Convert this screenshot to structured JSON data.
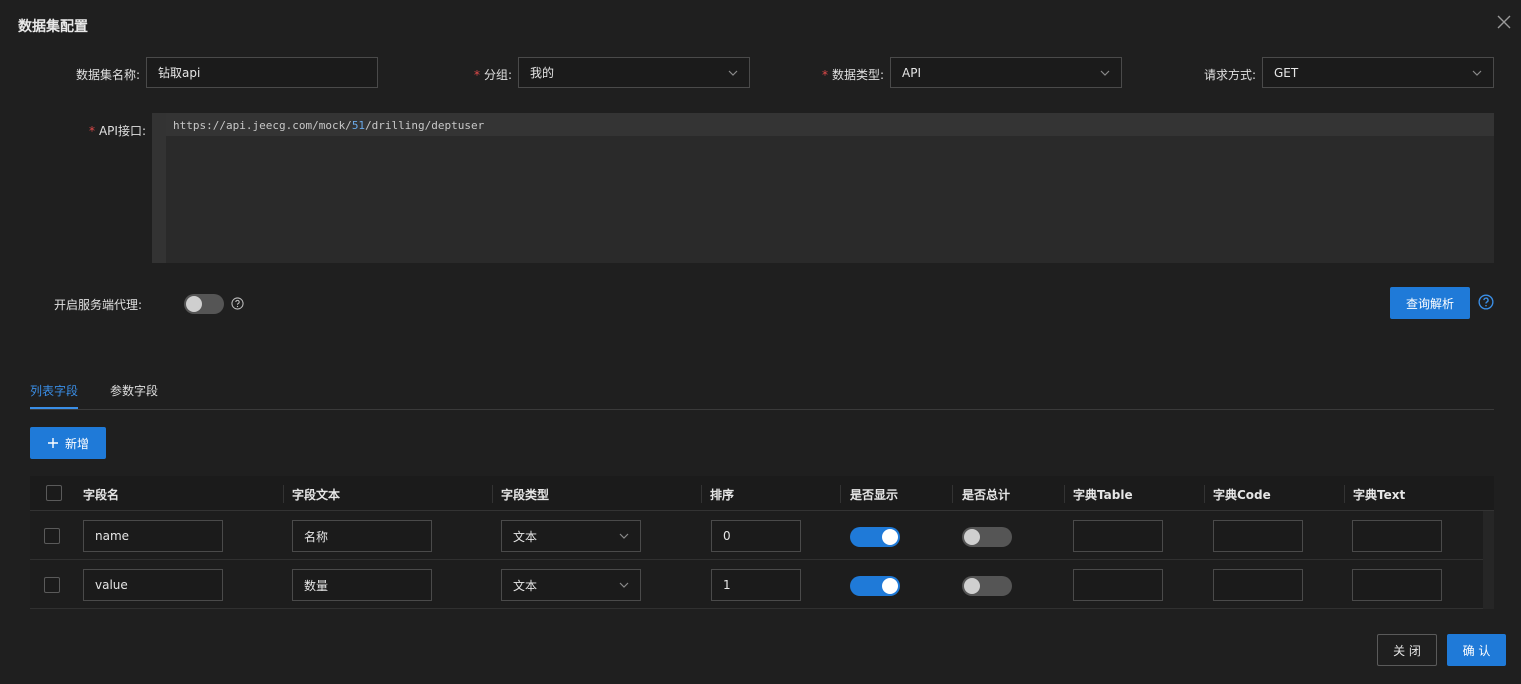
{
  "dialog": {
    "title": "数据集配置"
  },
  "form": {
    "name": {
      "label": "数据集名称:",
      "value": "钻取api"
    },
    "group": {
      "label": "分组:",
      "value": "我的",
      "required": true
    },
    "data_type": {
      "label": "数据类型:",
      "value": "API",
      "required": true
    },
    "method": {
      "label": "请求方式:",
      "value": "GET"
    },
    "api": {
      "label": "API接口:",
      "required": true,
      "url_prefix": "https://api.jeecg.com/mock/",
      "url_number": "51",
      "url_suffix": "/drilling/deptuser"
    },
    "proxy": {
      "label": "开启服务端代理:",
      "enabled": false
    },
    "query_button": "查询解析"
  },
  "tabs": [
    {
      "label": "列表字段",
      "active": true
    },
    {
      "label": "参数字段",
      "active": false
    }
  ],
  "add_button": "新增",
  "table": {
    "columns": [
      "字段名",
      "字段文本",
      "字段类型",
      "排序",
      "是否显示",
      "是否总计",
      "字典Table",
      "字典Code",
      "字典Text"
    ],
    "rows": [
      {
        "field_name": "name",
        "field_text": "名称",
        "field_type": "文本",
        "order": "0",
        "show": true,
        "total": false,
        "dict_table": "",
        "dict_code": "",
        "dict_text": ""
      },
      {
        "field_name": "value",
        "field_text": "数量",
        "field_type": "文本",
        "order": "1",
        "show": true,
        "total": false,
        "dict_table": "",
        "dict_code": "",
        "dict_text": ""
      }
    ]
  },
  "footer": {
    "close_button": "关 闭",
    "confirm_button": "确 认"
  },
  "colors": {
    "background": "#1f1f1f",
    "primary": "#1f7ad8",
    "required": "#e04a4a",
    "tab_active": "#3a8ee6"
  },
  "icons": [
    "close-icon",
    "chevron-down-icon",
    "question-circle-icon",
    "plus-icon"
  ]
}
